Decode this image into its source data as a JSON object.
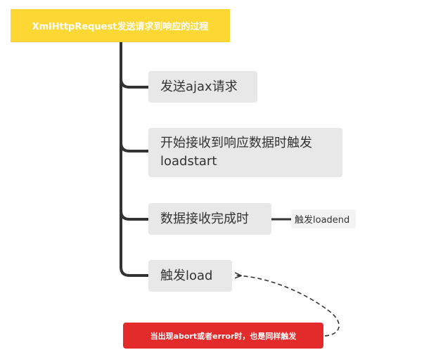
{
  "colors": {
    "root_fill": "#fdd835",
    "child_fill": "#e8e8e8",
    "sub_fill": "#f4f4f4",
    "note_fill": "#e32b2b",
    "line": "#333333"
  },
  "root": {
    "label": "XmlHttpRequest发送请求到响应的过程"
  },
  "children": [
    {
      "lines": [
        "发送ajax请求"
      ]
    },
    {
      "lines": [
        "开始接收到响应数据时触发",
        "loadstart"
      ]
    },
    {
      "lines": [
        "数据接收完成时"
      ],
      "sub": "触发loadend"
    },
    {
      "lines": [
        "触发load"
      ]
    }
  ],
  "note": {
    "label": "当出现abort或者error时，也是同样触发"
  }
}
